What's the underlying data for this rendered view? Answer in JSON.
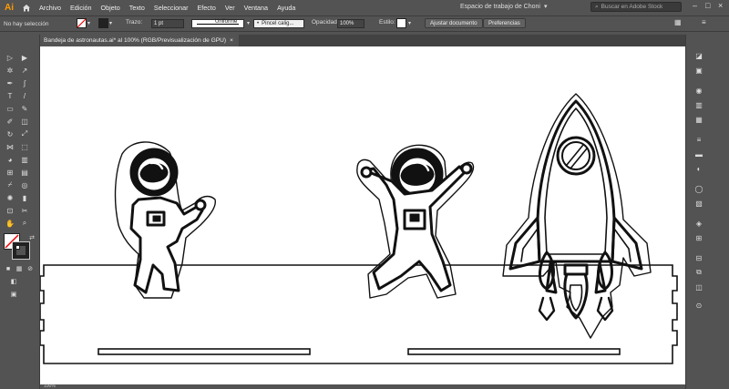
{
  "app": {
    "logo": "Ai",
    "workspace": "Espacio de trabajo de Choni",
    "stock_placeholder": "Buscar en Adobe Stock"
  },
  "menu": [
    "Archivo",
    "Edición",
    "Objeto",
    "Texto",
    "Seleccionar",
    "Efecto",
    "Ver",
    "Ventana",
    "Ayuda"
  ],
  "control": {
    "selection": "No hay selección",
    "stroke_label": "Trazo:",
    "stroke_value": "1 pt",
    "profile": "Uniforme",
    "brush": "Pincel calig...",
    "opacity_label": "Opacidad:",
    "opacity_value": "100%",
    "style_label": "Estilo:",
    "align_doc": "Ajustar documento",
    "prefs": "Preferencias"
  },
  "document": {
    "tab_title": "Bandeja de astronautas.ai* al 100% (RGB/Previsualización de GPU)",
    "close": "×"
  },
  "status": {
    "zoom": "100%"
  },
  "icons": {
    "home": "home-icon",
    "search": "search-icon",
    "chevron": "chevron-down-icon"
  },
  "colors": {
    "ui_bg": "#535353",
    "canvas": "#ffffff",
    "logo": "#ff9a00",
    "ink": "#111111"
  }
}
